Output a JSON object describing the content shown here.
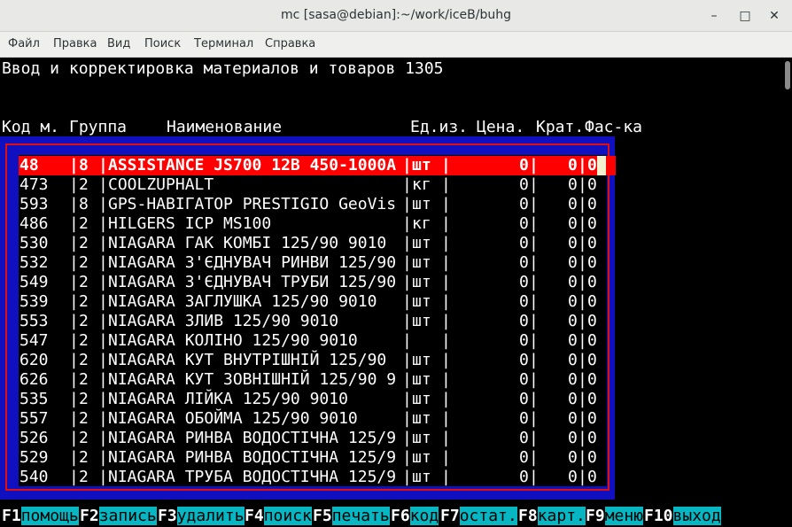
{
  "window": {
    "title": "mc [sasa@debian]:~/work/iceB/buhg"
  },
  "menu": [
    "Файл",
    "Правка",
    "Вид",
    "Поиск",
    "Терминал",
    "Справка"
  ],
  "screen": {
    "heading": "Ввод и корректировка материалов и товаров 1305",
    "columns": {
      "code": "Код м.",
      "group": "Группа",
      "name": "Наименование",
      "unit": "Ед.из.",
      "price": "Цена.",
      "krat": "Крат.",
      "fas": "Фас-ка"
    },
    "rows": [
      {
        "code": "48",
        "group": "8",
        "name": "ASSISTANCE JS700 12B 450-1000A",
        "unit": "шт",
        "price": "0",
        "krat": "0",
        "fas": "0"
      },
      {
        "code": "473",
        "group": "2",
        "name": "COOLZUPHALT",
        "unit": "кг",
        "price": "0",
        "krat": "0",
        "fas": "0"
      },
      {
        "code": "593",
        "group": "8",
        "name": "GPS-НАВІГАТОР PRESTIGIO GeoVis",
        "unit": "шт",
        "price": "0",
        "krat": "0",
        "fas": "0"
      },
      {
        "code": "486",
        "group": "2",
        "name": "HILGERS ICP MS100",
        "unit": "кг",
        "price": "0",
        "krat": "0",
        "fas": "0"
      },
      {
        "code": "530",
        "group": "2",
        "name": "NIAGARA ГАК КОМБІ 125/90 9010",
        "unit": "шт",
        "price": "0",
        "krat": "0",
        "fas": "0"
      },
      {
        "code": "532",
        "group": "2",
        "name": "NIAGARA З'ЄДНУВАЧ РИНВИ 125/90",
        "unit": "шт",
        "price": "0",
        "krat": "0",
        "fas": "0"
      },
      {
        "code": "549",
        "group": "2",
        "name": "NIAGARA З'ЄДНУВАЧ ТРУБИ 125/90",
        "unit": "шт",
        "price": "0",
        "krat": "0",
        "fas": "0"
      },
      {
        "code": "539",
        "group": "2",
        "name": "NIAGARA ЗАГЛУШКА 125/90 9010",
        "unit": "шт",
        "price": "0",
        "krat": "0",
        "fas": "0"
      },
      {
        "code": "553",
        "group": "2",
        "name": "NIAGARA ЗЛИВ 125/90 9010",
        "unit": "шт",
        "price": "0",
        "krat": "0",
        "fas": "0"
      },
      {
        "code": "547",
        "group": "2",
        "name": "NIAGARA КОЛІНО 125/90 9010",
        "unit": "",
        "price": "0",
        "krat": "0",
        "fas": "0"
      },
      {
        "code": "620",
        "group": "2",
        "name": "NIAGARA КУТ ВНУТРІШНІЙ 125/90",
        "unit": "шт",
        "price": "0",
        "krat": "0",
        "fas": "0"
      },
      {
        "code": "626",
        "group": "2",
        "name": "NIAGARA КУТ ЗОВНІШНІЙ 125/90 9",
        "unit": "шт",
        "price": "0",
        "krat": "0",
        "fas": "0"
      },
      {
        "code": "535",
        "group": "2",
        "name": "NIAGARA ЛІЙКА 125/90 9010",
        "unit": "шт",
        "price": "0",
        "krat": "0",
        "fas": "0"
      },
      {
        "code": "557",
        "group": "2",
        "name": "NIAGARA ОБОЙМА 125/90 9010",
        "unit": "шт",
        "price": "0",
        "krat": "0",
        "fas": "0"
      },
      {
        "code": "526",
        "group": "2",
        "name": "NIAGARA РИНВА ВОДОСТІЧНА 125/9",
        "unit": "шт",
        "price": "0",
        "krat": "0",
        "fas": "0"
      },
      {
        "code": "529",
        "group": "2",
        "name": "NIAGARA РИНВА ВОДОСТІЧНА 125/9",
        "unit": "шт",
        "price": "0",
        "krat": "0",
        "fas": "0"
      },
      {
        "code": "540",
        "group": "2",
        "name": "NIAGARA ТРУБА ВОДОСТІЧНА 125/9",
        "unit": "шт",
        "price": "0",
        "krat": "0",
        "fas": "0"
      }
    ],
    "selected_index": 0
  },
  "fkeys": [
    {
      "key": "F1",
      "label": "помощь"
    },
    {
      "key": "F2",
      "label": "запись"
    },
    {
      "key": "F3",
      "label": "удалить"
    },
    {
      "key": "F4",
      "label": "поиск"
    },
    {
      "key": "F5",
      "label": "печать"
    },
    {
      "key": "F6",
      "label": "код"
    },
    {
      "key": "F7",
      "label": "остат."
    },
    {
      "key": "F8",
      "label": "карт."
    },
    {
      "key": "F9",
      "label": "меню"
    },
    {
      "key": "F10",
      "label": "выход"
    }
  ],
  "colors": {
    "frame_blue": "#1010c0",
    "frame_red": "#e01010",
    "selection_red": "#ff0000",
    "fkey_label_bg": "#06b6c2"
  }
}
